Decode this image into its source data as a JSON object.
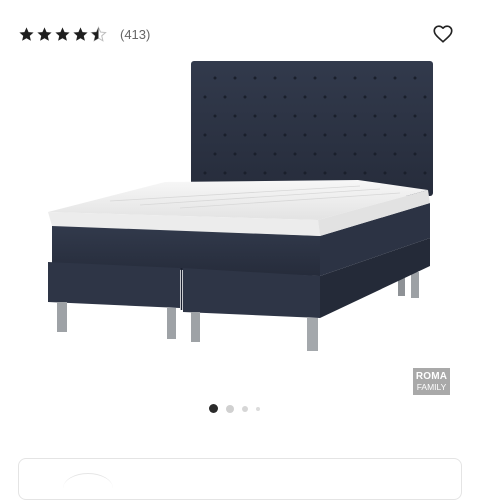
{
  "rating": {
    "stars": 4.5,
    "count_text": "(413)"
  },
  "icons": {
    "wishlist": "heart-outline-icon",
    "star": "star-icon"
  },
  "colors": {
    "star": "#1f1f1f",
    "bed_fabric": "#2a3142",
    "active_dot": "#2b2b2b",
    "badge_bg": "#a9a9a9"
  },
  "brand_badge": {
    "line1": "ROMA",
    "line2": "FAMILY"
  },
  "carousel": {
    "total": 4,
    "active": 1
  }
}
